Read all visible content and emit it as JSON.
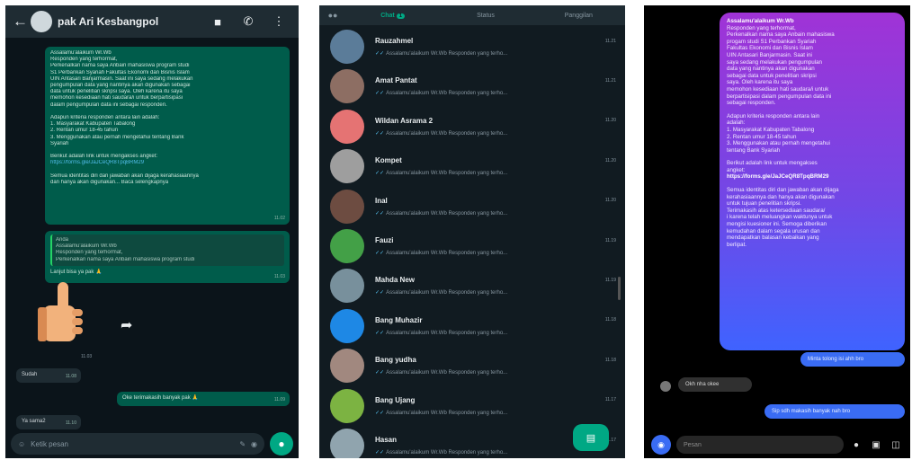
{
  "panel1": {
    "contact_name": "pak Ari Kesbangpol",
    "icons": {
      "back": "arrow-left-icon",
      "video": "video-camera-icon",
      "call": "phone-icon",
      "menu": "more-vertical-icon"
    },
    "message1": {
      "lines": [
        "Assalamu'alaikum Wr.Wb",
        "Responden yang terhormat,",
        "Perkenalkan nama saya Anbain mahasiswa program studi",
        "S1 Perbankan Syariah Fakultas Ekonomi dan Bisnis Islam",
        "UIN Antasari Banjarmasin. Saat ini saya sedang melakukan",
        "pengumpulan data yang nantinya akan digunakan sebagai",
        "data untuk penelitian skripsi saya. Oleh karena itu saya",
        "memohon kesediaan hati saudara/i untuk berpartisipasi",
        "dalam pengumpulan data ini sebagai responden.",
        "",
        "Adapun kriteria responden antara lain adalah:",
        "1. Masyarakat Kabupaten Tabalong",
        "2. Rentan umur 18-45 tahun",
        "3. Menggunakan atau pernah mengetahui tentang Bank",
        "Syariah",
        "",
        "Berikut adalah link untuk mengakses angket:",
        "https://forms.gle/JaJCeQR8TpqBRM29",
        "",
        "Semua identitas diri dan jawaban akan dijaga kerahasiaannya",
        "dan hanya akan digunakan... Baca selengkapnya"
      ],
      "time": "11.02"
    },
    "message2": {
      "quote_lines": [
        "Anda",
        "Assalamu'alaikum Wr.Wb",
        "Responden yang terhormat,",
        "Perkenalkan nama saya Anbain mahasiswa program studi"
      ],
      "text": "Lanjut bisa ya pak 🙏",
      "time": "11.03"
    },
    "sticker_time": "11.03",
    "incoming1": {
      "text": "Sudah",
      "time": "11.08"
    },
    "outgoing2": {
      "text": "Oke terimakasih banyak pak 🙏",
      "time": "11.09"
    },
    "incoming2": {
      "text": "Ya sama2",
      "time": "11.10"
    },
    "input_placeholder": "Ketik pesan"
  },
  "panel2": {
    "tabs": [
      {
        "label": "Chat",
        "badge": "1"
      },
      {
        "label": "Status"
      },
      {
        "label": "Panggilan"
      }
    ],
    "chats": [
      {
        "name": "Rauzahmel",
        "time": "11.21",
        "preview": "Assalamu'alaikum Wr.Wb Responden yang terho...",
        "color": "#5b7c99"
      },
      {
        "name": "Amat Pantat",
        "time": "11.21",
        "preview": "Assalamu'alaikum Wr.Wb Responden yang terho...",
        "color": "#8d6e63"
      },
      {
        "name": "Wildan Asrama 2",
        "time": "11.20",
        "preview": "Assalamu'alaikum Wr.Wb Responden yang terho...",
        "color": "#e57373"
      },
      {
        "name": "Kompet",
        "time": "11.20",
        "preview": "Assalamu'alaikum Wr.Wb Responden yang terho...",
        "color": "#9e9e9e"
      },
      {
        "name": "Inal",
        "time": "11.20",
        "preview": "Assalamu'alaikum Wr.Wb Responden yang terho...",
        "color": "#6d4c41"
      },
      {
        "name": "Fauzi",
        "time": "11.19",
        "preview": "Assalamu'alaikum Wr.Wb Responden yang terho...",
        "color": "#43a047"
      },
      {
        "name": "Mahda New",
        "time": "11.19",
        "preview": "Assalamu'alaikum Wr.Wb Responden yang terho...",
        "color": "#78909c"
      },
      {
        "name": "Bang Muhazir",
        "time": "11.18",
        "preview": "Assalamu'alaikum Wr.Wb Responden yang terho...",
        "color": "#1e88e5"
      },
      {
        "name": "Bang yudha",
        "time": "11.18",
        "preview": "Assalamu'alaikum Wr.Wb Responden yang terho...",
        "color": "#a1887f"
      },
      {
        "name": "Bang Ujang",
        "time": "11.17",
        "preview": "Assalamu'alaikum Wr.Wb Responden yang terho...",
        "color": "#7cb342"
      },
      {
        "name": "Hasan",
        "time": "11.17",
        "preview": "Assalamu'alaikum Wr.Wb Responden yang terho...",
        "color": "#90a4ae"
      }
    ]
  },
  "panel3": {
    "message_lines": [
      {
        "t": "Assalamu'alaikum Wr.Wb",
        "b": true
      },
      {
        "t": "Responden yang terhormat,"
      },
      {
        "t": "Perkenalkan nama saya Anbain mahasiswa"
      },
      {
        "t": "progam studi S1 Perbankan Syariah"
      },
      {
        "t": "Fakultas Ekonomi dan Bisnis Islam"
      },
      {
        "t": "UIN Antasari Banjarmasin. Saat ini"
      },
      {
        "t": "saya sedang melakukan pengumpulan"
      },
      {
        "t": "data yang nantinya akan digunakan"
      },
      {
        "t": "sebagai data untuk penelitian skripsi"
      },
      {
        "t": "saya. Oleh karena itu saya"
      },
      {
        "t": "memohon kesediaan hati saudara/i untuk"
      },
      {
        "t": "berpartisipasi dalam pengumpulan data ini"
      },
      {
        "t": "sebagai responden."
      },
      {
        "t": ""
      },
      {
        "t": "Adapun kriteria responden antara lain"
      },
      {
        "t": "adalah:"
      },
      {
        "t": "1. Masyarakat Kabupaten Tabalong"
      },
      {
        "t": "2. Rentan umur 18-45 tahun"
      },
      {
        "t": "3. Menggunakan atau pernah mengetahui"
      },
      {
        "t": "tentang Bank Syariah"
      },
      {
        "t": ""
      },
      {
        "t": "Berikut adalah link untuk mengakses"
      },
      {
        "t": "angket:"
      },
      {
        "t": "https://forms.gle/JaJCeQR8TpqBRM29",
        "b": true
      },
      {
        "t": ""
      },
      {
        "t": "Semua identitas diri dan jawaban akan dijaga"
      },
      {
        "t": "kerahasiaannya dan hanya akan digunakan"
      },
      {
        "t": "untuk tujuan penelitian skripsi."
      },
      {
        "t": "Terimakasih atas ketersediaan saudara/"
      },
      {
        "t": "i karena telah meluangkan waktunya untuk"
      },
      {
        "t": "mengisi kuesioner ini. Semoga diberikan"
      },
      {
        "t": "kemudahan dalam segala urusan dan"
      },
      {
        "t": "mendapatkan balasan kebaikan yang"
      },
      {
        "t": "berlipat."
      }
    ],
    "pill1": "Minta tolong isi ahh bro",
    "reply": "Okh nha okee",
    "pill2": "Sip sdh makasih banyak nah bro",
    "input_placeholder": "Pesan"
  }
}
